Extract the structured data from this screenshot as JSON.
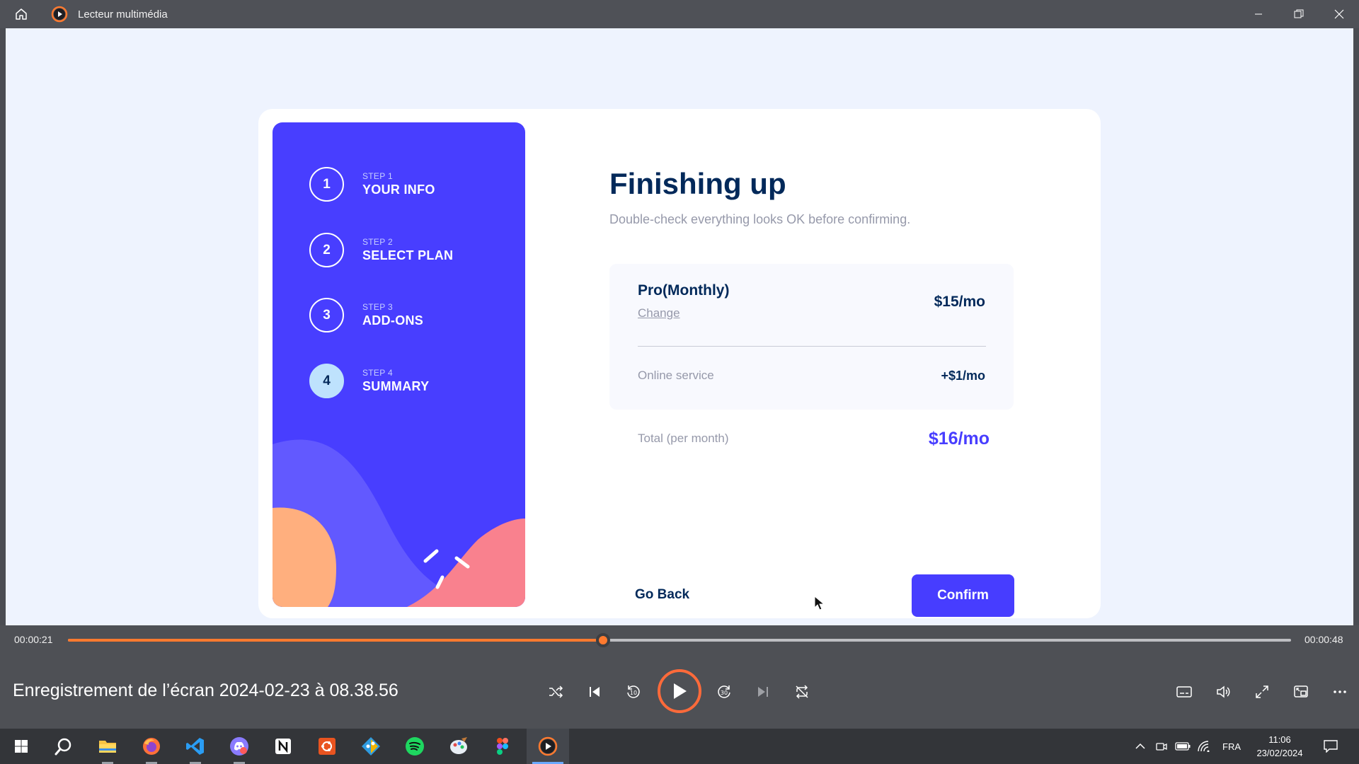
{
  "window": {
    "title": "Lecteur multimédia"
  },
  "steps": [
    {
      "num": "1",
      "label_small": "STEP 1",
      "label": "YOUR INFO"
    },
    {
      "num": "2",
      "label_small": "STEP 2",
      "label": "SELECT PLAN"
    },
    {
      "num": "3",
      "label_small": "STEP 3",
      "label": "ADD-ONS"
    },
    {
      "num": "4",
      "label_small": "STEP 4",
      "label": "SUMMARY"
    }
  ],
  "summary": {
    "title": "Finishing up",
    "subtitle": "Double-check everything looks OK before confirming.",
    "plan_name": "Pro(Monthly)",
    "change_label": "Change",
    "plan_price": "$15/mo",
    "addon_name": "Online service",
    "addon_price": "+$1/mo",
    "total_label": "Total (per month)",
    "total_value": "$16/mo",
    "back_label": "Go Back",
    "confirm_label": "Confirm"
  },
  "player": {
    "elapsed": "00:00:21",
    "duration": "00:00:48",
    "progress": 0.4375,
    "media_title": "Enregistrement de l’écran 2024-02-23 à 08.38.56"
  },
  "taskbar": {
    "language": "FRA",
    "time": "11:06",
    "date": "23/02/2024"
  },
  "colors": {
    "accent": "#483eff",
    "denim": "#02295a",
    "seek": "#ff7a2f"
  }
}
